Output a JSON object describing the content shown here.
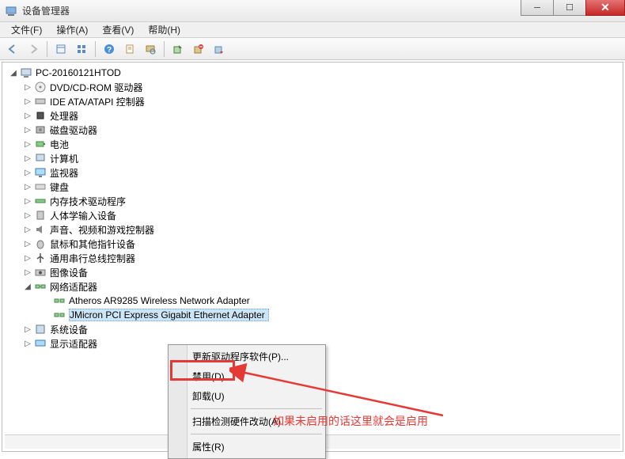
{
  "window": {
    "title": "设备管理器"
  },
  "menu": {
    "file": "文件(F)",
    "action": "操作(A)",
    "view": "查看(V)",
    "help": "帮助(H)"
  },
  "tree": {
    "root": "PC-20160121HTOD",
    "nodes": {
      "dvd": "DVD/CD-ROM 驱动器",
      "ide": "IDE ATA/ATAPI 控制器",
      "cpu": "处理器",
      "disk": "磁盘驱动器",
      "battery": "电池",
      "computer": "计算机",
      "monitor": "监视器",
      "keyboard": "键盘",
      "memtech": "内存技术驱动程序",
      "hid": "人体学输入设备",
      "sound": "声音、视频和游戏控制器",
      "mouse": "鼠标和其他指针设备",
      "usb": "通用串行总线控制器",
      "imaging": "图像设备",
      "network": "网络适配器",
      "net_atheros": "Atheros AR9285 Wireless Network Adapter",
      "net_jmicron": "JMicron PCI Express Gigabit Ethernet Adapter",
      "system": "系统设备",
      "display": "显示适配器"
    }
  },
  "context_menu": {
    "update_driver": "更新驱动程序软件(P)...",
    "disable": "禁用(D)",
    "uninstall": "卸载(U)",
    "scan": "扫描检测硬件改动(A)",
    "properties": "属性(R)"
  },
  "annotation": {
    "text": "如果未启用的话这里就会是启用"
  }
}
